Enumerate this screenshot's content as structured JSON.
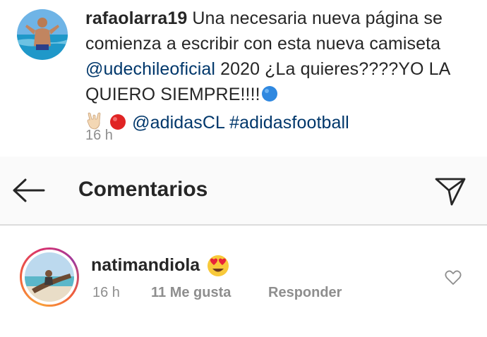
{
  "post": {
    "username": "rafaolarra19",
    "caption_part1": "Una necesaria nueva página se comienza a escribir con esta nueva camiseta",
    "mention_club": "@udechileoficial",
    "caption_part2": "2020 ¿La quieres????YO LA QUIERO SIEMPRE!!!!",
    "mention_brand": "@adidasCL",
    "hashtag": "#adidasfootball",
    "time": "16 h"
  },
  "header": {
    "title": "Comentarios"
  },
  "comment": {
    "username": "natimandiola",
    "time": "16 h",
    "likes": "11 Me gusta",
    "reply_label": "Responder"
  },
  "icons": {
    "back": "arrow-left-icon",
    "share": "paper-plane-icon",
    "like": "heart-outline-icon",
    "emoji_circle": "blue-circle-emoji",
    "emoji_hand": "rock-hand-emoji",
    "emoji_red": "red-circle-emoji",
    "emoji_heart_eyes": "heart-eyes-emoji"
  },
  "colors": {
    "text": "#262626",
    "muted": "#8e8e8e",
    "mention": "#00376b",
    "header_bg": "#fafafa"
  }
}
